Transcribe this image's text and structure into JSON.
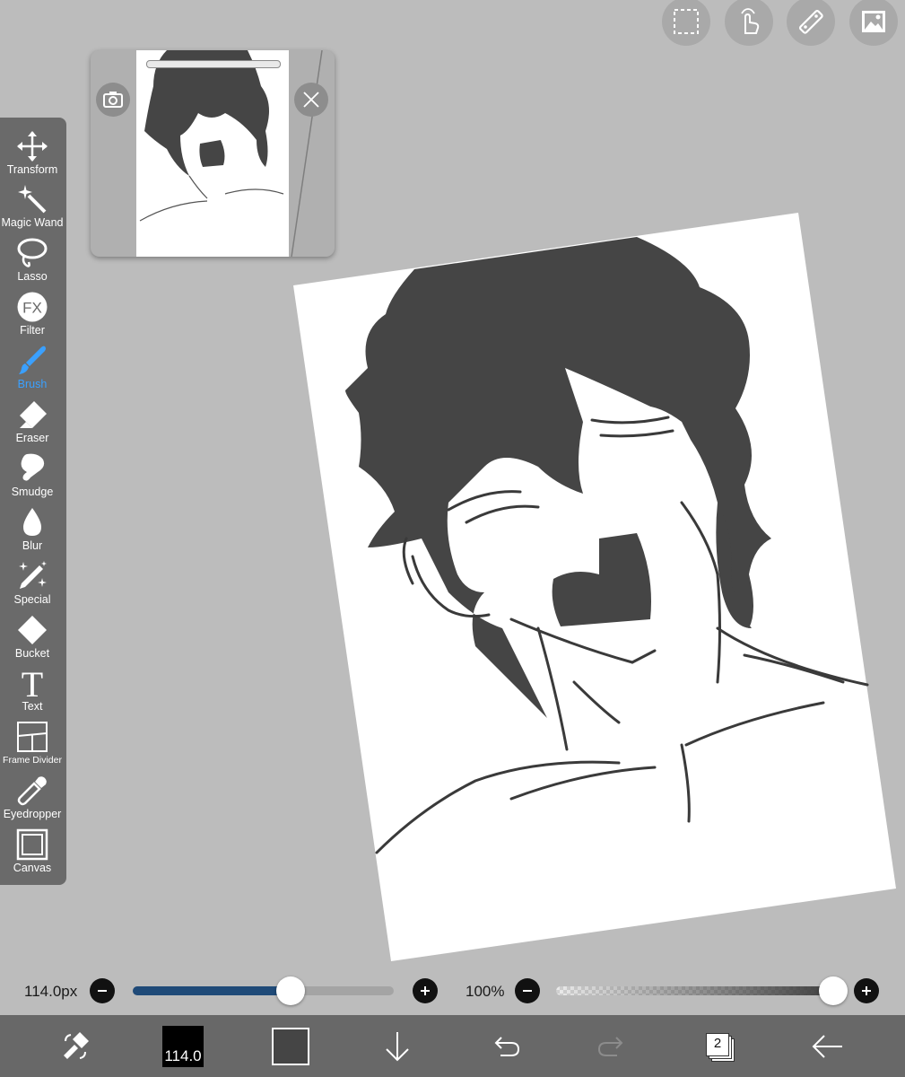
{
  "top_buttons": [
    {
      "name": "selection-icon"
    },
    {
      "name": "gesture-icon"
    },
    {
      "name": "ruler-icon"
    },
    {
      "name": "material-icon"
    }
  ],
  "tools": [
    {
      "label": "Transform",
      "icon": "move-arrows-icon"
    },
    {
      "label": "Magic Wand",
      "icon": "magic-wand-icon"
    },
    {
      "label": "Lasso",
      "icon": "lasso-icon"
    },
    {
      "label": "Filter",
      "icon": "fx-icon",
      "glyph": "FX"
    },
    {
      "label": "Brush",
      "icon": "brush-icon",
      "active": true
    },
    {
      "label": "Eraser",
      "icon": "eraser-icon"
    },
    {
      "label": "Smudge",
      "icon": "smudge-icon"
    },
    {
      "label": "Blur",
      "icon": "droplet-icon"
    },
    {
      "label": "Special",
      "icon": "sparkle-pen-icon"
    },
    {
      "label": "Bucket",
      "icon": "bucket-icon"
    },
    {
      "label": "Text",
      "icon": "text-icon",
      "glyph": "T"
    },
    {
      "label": "Frame Divider",
      "icon": "frame-divider-icon"
    },
    {
      "label": "Eyedropper",
      "icon": "eyedropper-icon"
    },
    {
      "label": "Canvas",
      "icon": "canvas-icon"
    }
  ],
  "brush_size": {
    "label": "114.0px",
    "fraction": 0.605
  },
  "opacity": {
    "label": "100%",
    "fraction": 1.0
  },
  "bottom_bar": {
    "brush_size_value": "114.0",
    "primary_color": "#000000",
    "secondary_color": "#454545",
    "layer_count": "2"
  },
  "colors": {
    "accent": "#3aa0ff",
    "slider_fill": "#1f4a78",
    "toolbar_bg": "#6a6a6a",
    "workspace_bg": "#bcbcbc",
    "ink": "#454545"
  }
}
